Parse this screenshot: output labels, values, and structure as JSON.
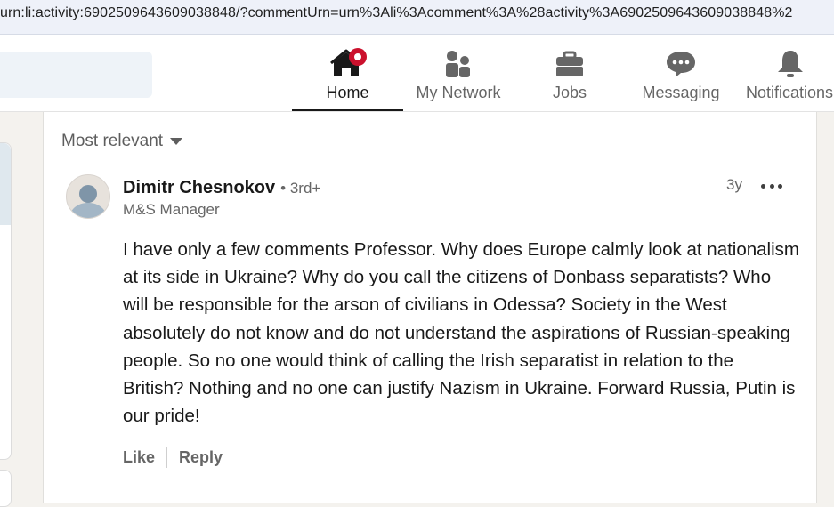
{
  "browser": {
    "url": "urn:li:activity:6902509643609038848/?commentUrn=urn%3Ali%3Acomment%3A%28activity%3A6902509643609038848%2"
  },
  "nav": {
    "items": [
      {
        "label": "Home",
        "icon": "home-icon",
        "active": true
      },
      {
        "label": "My Network",
        "icon": "network-icon"
      },
      {
        "label": "Jobs",
        "icon": "briefcase-icon"
      },
      {
        "label": "Messaging",
        "icon": "messaging-icon"
      },
      {
        "label": "Notifications",
        "icon": "bell-icon"
      }
    ],
    "accent": "#cb112d"
  },
  "comments": {
    "sort_label": "Most relevant",
    "items": [
      {
        "author": "Dimitr Chesnokov",
        "degree": "• 3rd+",
        "headline": "M&S Manager",
        "time": "3y",
        "text": "I have only a few comments Professor. Why does Europe calmly look at nationalism at its side in Ukraine? Why do you call the citizens of Donbass separatists? Who will be responsible for the arson of civilians in Odessa? Society in the West absolutely do not know and do not understand the aspirations of Russian-speaking people. So no one would think of calling the Irish separatist in relation to the British? Nothing and no one can justify Nazism in Ukraine. Forward Russia, Putin is our pride!",
        "like_label": "Like",
        "reply_label": "Reply"
      }
    ]
  }
}
